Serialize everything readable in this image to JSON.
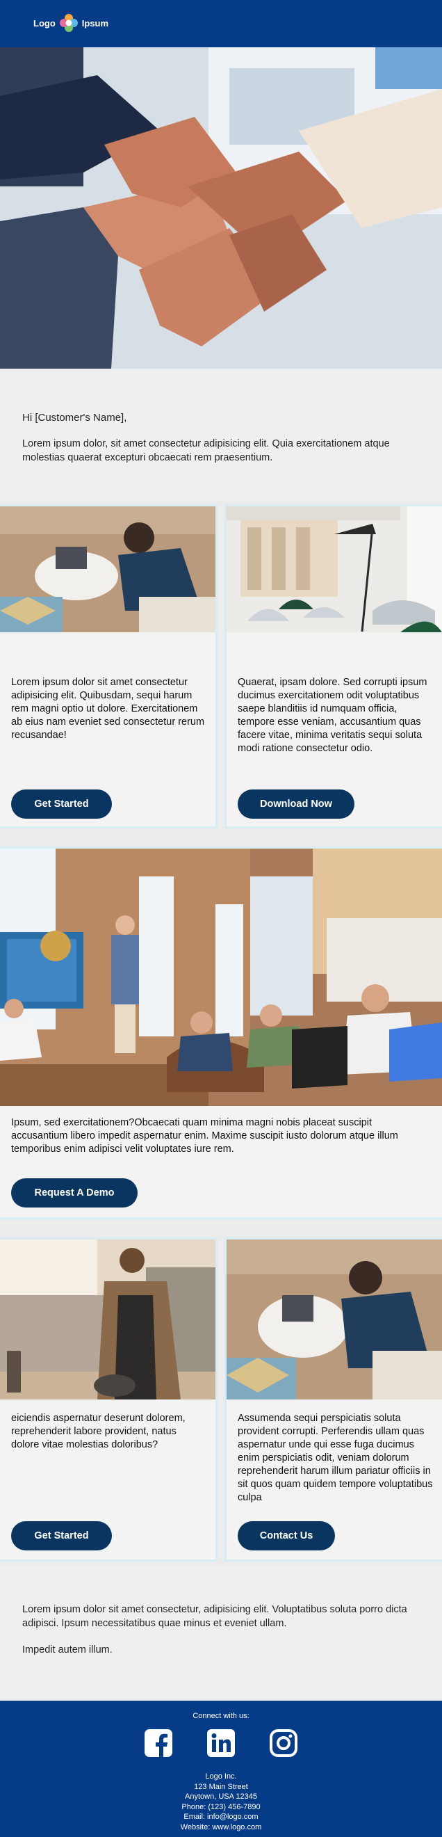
{
  "header": {
    "logo_left": "Logo",
    "logo_right": "Ipsum"
  },
  "intro": {
    "greeting": "Hi [Customer's Name],",
    "body": "Lorem ipsum dolor, sit amet consectetur adipisicing elit. Quia exercitationem atque molestias quaerat excepturi obcaecati rem praesentium."
  },
  "cards_row1": [
    {
      "text": "Lorem ipsum dolor sit amet consectetur adipisicing elit. Quibusdam, sequi harum rem magni optio ut dolore. Exercitationem ab eius nam eveniet sed consectetur rerum recusandae!",
      "button": "Get Started"
    },
    {
      "text": "Quaerat, ipsam dolore. Sed corrupti ipsum ducimus exercitationem odit voluptatibus saepe blanditiis id numquam officia, tempore esse veniam, accusantium quas facere vitae, minima veritatis sequi soluta modi ratione consectetur odio.",
      "button": "Download Now"
    }
  ],
  "wide_card": {
    "text": "Ipsum, sed exercitationem?Obcaecati quam minima magni nobis placeat suscipit accusantium libero impedit aspernatur enim. Maxime suscipit iusto dolorum atque illum temporibus enim adipisci velit voluptates iure rem.",
    "button": "Request A Demo"
  },
  "cards_row2": [
    {
      "text": "eiciendis aspernatur deserunt dolorem, reprehenderit labore provident, natus dolore vitae molestias doloribus?",
      "button": "Get Started"
    },
    {
      "text": "Assumenda sequi perspiciatis soluta provident corrupti. Perferendis ullam quas aspernatur unde qui esse fuga ducimus enim perspiciatis odit, veniam dolorum reprehenderit harum illum pariatur officiis in sit quos quam quidem tempore voluptatibus culpa",
      "button": "Contact Us"
    }
  ],
  "outro": {
    "p1": "Lorem ipsum dolor sit amet consectetur, adipisicing elit. Voluptatibus soluta porro dicta adipisci. Ipsum necessitatibus quae minus et eveniet ullam.",
    "p2": "Impedit autem illum."
  },
  "footer": {
    "connect": "Connect with us:",
    "social_icons": [
      "facebook-icon",
      "linkedin-icon",
      "instagram-icon"
    ],
    "company": "Logo Inc.",
    "street": "123 Main Street",
    "city": "Anytown, USA 12345",
    "phone": "Phone: (123) 456-7890",
    "email": "Email: info@logo.com",
    "website": "Website: www.logo.com"
  },
  "colors": {
    "brand": "#063b87",
    "button": "#0a3561",
    "card_border": "#d8edf3"
  }
}
